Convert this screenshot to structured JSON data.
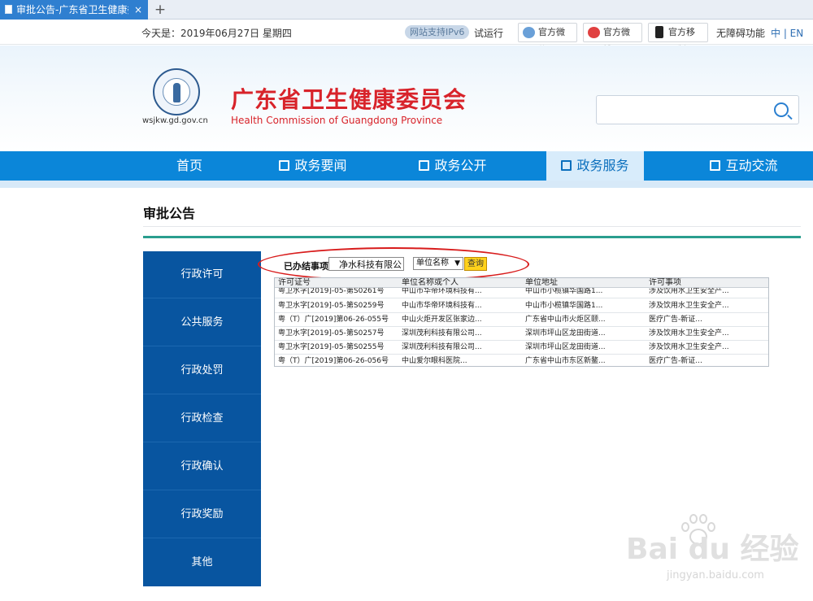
{
  "browser": {
    "tab_title": "审批公告-广东省卫生健康委员",
    "tab_close": "×",
    "new_tab": "+"
  },
  "topbar": {
    "date": "今天是：2019年06月27日 星期四",
    "ipv6": "网站支持IPv6",
    "trial": "试运行",
    "wechat": "官方微信",
    "weibo": "官方微博",
    "mobile": "官方移动版",
    "accessibility": "无障碍功能",
    "lang": "中 | EN"
  },
  "header": {
    "domain": "wsjkw.gd.gov.cn",
    "title": "广东省卫生健康委员会",
    "subtitle": "Health Commission of Guangdong Province",
    "search_placeholder": ""
  },
  "nav": {
    "items": [
      "首页",
      "政务要闻",
      "政务公开",
      "政务服务",
      "互动交流"
    ],
    "active": "政务服务"
  },
  "page": {
    "title": "审批公告"
  },
  "sidebar": {
    "items": [
      "行政许可",
      "公共服务",
      "行政处罚",
      "行政检查",
      "行政确认",
      "行政奖励",
      "其他"
    ]
  },
  "query": {
    "label": "已办结事项",
    "input_value": "净水科技有限公司",
    "select_value": "单位名称",
    "button": "查询"
  },
  "table": {
    "headers": [
      "许可证号",
      "单位名称或个人",
      "单位地址",
      "许可事项"
    ],
    "partial_row": [
      "粤卫水字[2019]-05-第S0261号",
      "中山市华帝环境科技有...",
      "中山市小榄镇华国路1...",
      "涉及饮用水卫生安全产..."
    ],
    "rows": [
      [
        "粤卫水字[2019]-05-第S0259号",
        "中山市华帝环境科技有...",
        "中山市小榄镇华国路1...",
        "涉及饮用水卫生安全产..."
      ],
      [
        "粤（T）广[2019]第06-26-055号",
        "中山火炬开发区张家边...",
        "广东省中山市火炬区颐...",
        "医疗广告-新证..."
      ],
      [
        "粤卫水字[2019]-05-第S0257号",
        "深圳茂利科技有限公司...",
        "深圳市坪山区龙田街道...",
        "涉及饮用水卫生安全产..."
      ],
      [
        "粤卫水字[2019]-05-第S0255号",
        "深圳茂利科技有限公司...",
        "深圳市坪山区龙田街道...",
        "涉及饮用水卫生安全产..."
      ],
      [
        "粤（T）广[2019]第06-26-056号",
        "中山爱尔眼科医院...",
        "广东省中山市东区新鳌...",
        "医疗广告-新证..."
      ]
    ]
  },
  "watermark": {
    "brand": "Bai du 经验",
    "url": "jingyan.baidu.com"
  },
  "colors": {
    "nav_blue": "#0b86d9",
    "sidebar_blue": "#0855a0",
    "title_red": "#d8232a",
    "teal_rule": "#2a9e8e",
    "annotation_red": "#d81c1c"
  }
}
